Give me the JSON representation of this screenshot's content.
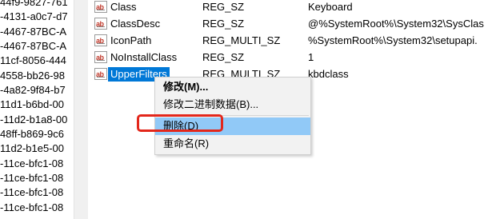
{
  "tree": {
    "rows": [
      "44f9-9827-761",
      "-4131-a0c7-d7",
      "-4467-87BC-A",
      "-4467-87BC-A",
      "11cf-8056-444",
      "4558-bb26-98",
      "-4a82-9f84-b7",
      "11d1-b6bd-00",
      "-11d2-b1a8-00",
      "48ff-b869-9c6",
      "11d2-b1e5-00",
      "-11ce-bfc1-08",
      "-11ce-bfc1-08",
      "-11ce-bfc1-08",
      "-11ce-bfc1-08"
    ]
  },
  "values": {
    "rows": [
      {
        "name": "Class",
        "type": "REG_SZ",
        "data": "Keyboard",
        "icon": "ab-icon"
      },
      {
        "name": "ClassDesc",
        "type": "REG_SZ",
        "data": "@%SystemRoot%\\System32\\SysClas",
        "icon": "ab-icon"
      },
      {
        "name": "IconPath",
        "type": "REG_MULTI_SZ",
        "data": "%SystemRoot%\\System32\\setupapi.",
        "icon": "ab-icon"
      },
      {
        "name": "NoInstallClass",
        "type": "REG_SZ",
        "data": "1",
        "icon": "ab-icon"
      },
      {
        "name": "UpperFilters",
        "type": "REG_MULTI_SZ",
        "data": "kbdclass",
        "icon": "ab-icon",
        "selected": true
      }
    ],
    "icon_label": "ab"
  },
  "context_menu": {
    "items": [
      {
        "label": "修改(M)..."
      },
      {
        "label": "修改二进制数据(B)..."
      },
      {
        "label": "删除(D)"
      },
      {
        "label": "重命名(R)"
      }
    ]
  },
  "colors": {
    "selection": "#0078d7",
    "menu_highlight": "#91c9f7",
    "annotation_box": "#e3271b"
  }
}
